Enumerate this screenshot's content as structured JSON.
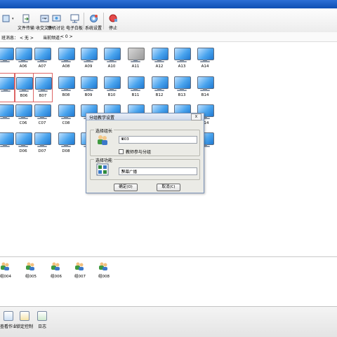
{
  "toolbar": {
    "file_transfer": "文件传输",
    "collect_files": "收交文件",
    "discussion": "联机讨论",
    "whiteboard": "电子白板",
    "settings": "系统设置",
    "stop": "停止"
  },
  "status": {
    "class_label": "班消息：",
    "class_value": "< 无 >",
    "channel_label": "当前频道：",
    "channel_value": "< 0 >"
  },
  "computers": [
    {
      "name": "",
      "on": true,
      "sel": false
    },
    {
      "name": "A06",
      "on": true,
      "sel": false
    },
    {
      "name": "A07",
      "on": true,
      "sel": false
    },
    {
      "name": "A08",
      "on": true,
      "sel": false
    },
    {
      "name": "A09",
      "on": true,
      "sel": false
    },
    {
      "name": "A10",
      "on": true,
      "sel": false
    },
    {
      "name": "A11",
      "on": false,
      "sel": false
    },
    {
      "name": "A12",
      "on": true,
      "sel": false
    },
    {
      "name": "A13",
      "on": true,
      "sel": false
    },
    {
      "name": "A14",
      "on": true,
      "sel": false
    },
    {
      "name": "",
      "on": true,
      "sel": true
    },
    {
      "name": "B06",
      "on": true,
      "sel": true
    },
    {
      "name": "B07",
      "on": true,
      "sel": true
    },
    {
      "name": "B08",
      "on": true,
      "sel": false
    },
    {
      "name": "B09",
      "on": true,
      "sel": false
    },
    {
      "name": "B10",
      "on": true,
      "sel": false
    },
    {
      "name": "B11",
      "on": true,
      "sel": false
    },
    {
      "name": "B12",
      "on": true,
      "sel": false
    },
    {
      "name": "B13",
      "on": true,
      "sel": false
    },
    {
      "name": "B14",
      "on": true,
      "sel": false
    },
    {
      "name": "",
      "on": true,
      "sel": false
    },
    {
      "name": "C06",
      "on": true,
      "sel": false
    },
    {
      "name": "C07",
      "on": true,
      "sel": false
    },
    {
      "name": "C08",
      "on": true,
      "sel": false
    },
    {
      "name": "",
      "on": true,
      "sel": false
    },
    {
      "name": "",
      "on": true,
      "sel": false
    },
    {
      "name": "",
      "on": true,
      "sel": false
    },
    {
      "name": "",
      "on": true,
      "sel": false
    },
    {
      "name": "",
      "on": true,
      "sel": false
    },
    {
      "name": "C14",
      "on": true,
      "sel": false
    },
    {
      "name": "",
      "on": true,
      "sel": false
    },
    {
      "name": "D06",
      "on": true,
      "sel": false
    },
    {
      "name": "D07",
      "on": true,
      "sel": false
    },
    {
      "name": "D08",
      "on": true,
      "sel": false
    },
    {
      "name": "",
      "on": true,
      "sel": false
    },
    {
      "name": "",
      "on": true,
      "sel": false
    },
    {
      "name": "",
      "on": true,
      "sel": false
    },
    {
      "name": "",
      "on": true,
      "sel": false
    },
    {
      "name": "",
      "on": true,
      "sel": false
    },
    {
      "name": "",
      "on": true,
      "sel": false
    }
  ],
  "dialog": {
    "title": "分组教学设置",
    "close": "X",
    "leader_group": "选择组长",
    "leader_value": "B03",
    "teacher_join": "教师参与分组",
    "function_group": "选择功能",
    "function_value": "屏幕广播",
    "ok": "确定(O)",
    "cancel": "取消(C)"
  },
  "groups": [
    "组004",
    "组005",
    "组006",
    "组007",
    "组008"
  ],
  "footer": {
    "check_homework": "查看作业",
    "lock_control": "锁定控制",
    "log": "日志"
  },
  "colors": {
    "title_blue": "#1c5fc4",
    "monitor_blue": "#4aa4ee",
    "selected_border": "#dd6666"
  }
}
